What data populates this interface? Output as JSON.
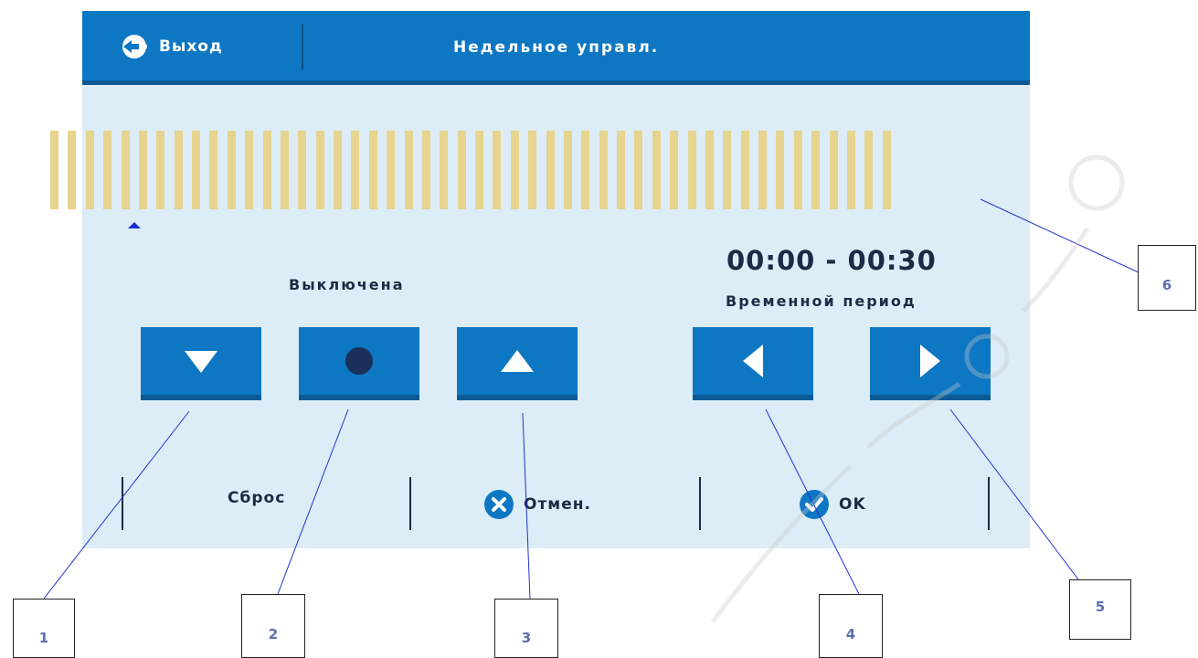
{
  "header": {
    "exit_label": "Выход",
    "title": "Недельное управл."
  },
  "schedule": {
    "slot_count": 48,
    "slot_state_off_color": "#e6d48f",
    "selected_slot": 1
  },
  "state": {
    "label": "Выключена"
  },
  "period": {
    "time_range": "00:00 - 00:30",
    "label": "Временной период"
  },
  "buttons": {
    "down_icon": "triangle-down-icon",
    "set_icon": "dot-icon",
    "up_icon": "triangle-up-icon",
    "prev_icon": "triangle-left-icon",
    "next_icon": "triangle-right-icon"
  },
  "footer": {
    "reset_label": "Сброс",
    "cancel_label": "Отмен.",
    "ok_label": "OK"
  },
  "callouts": [
    "1",
    "2",
    "3",
    "4",
    "5",
    "6"
  ],
  "colors": {
    "header": "#0e77c3",
    "screen_bg": "#dcedf7",
    "text": "#1e2a44",
    "callout_number": "#5a6fae"
  }
}
